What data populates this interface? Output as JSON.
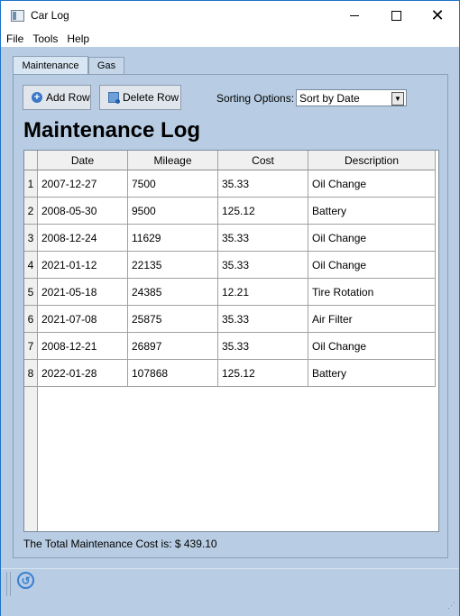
{
  "window": {
    "title": "Car Log"
  },
  "menu": [
    "File",
    "Tools",
    "Help"
  ],
  "tabs": [
    "Maintenance",
    "Gas"
  ],
  "toolbar": {
    "add_label": "Add Row",
    "delete_label": "Delete Row",
    "sort_label": "Sorting Options:",
    "sort_value": "Sort by Date"
  },
  "heading": "Maintenance Log",
  "table": {
    "columns": [
      "Date",
      "Mileage",
      "Cost",
      "Description"
    ],
    "rows": [
      [
        "2007-12-27",
        "7500",
        "35.33",
        "Oil Change"
      ],
      [
        "2008-05-30",
        "9500",
        "125.12",
        "Battery"
      ],
      [
        "2008-12-24",
        "11629",
        "35.33",
        "Oil Change"
      ],
      [
        "2021-01-12",
        "22135",
        "35.33",
        "Oil Change"
      ],
      [
        "2021-05-18",
        "24385",
        "12.21",
        "Tire Rotation"
      ],
      [
        "2021-07-08",
        "25875",
        "35.33",
        "Air Filter"
      ],
      [
        "2008-12-21",
        "26897",
        "35.33",
        "Oil Change"
      ],
      [
        "2022-01-28",
        "107868",
        "125.12",
        "Battery"
      ]
    ],
    "row_numbers": [
      "1",
      "2",
      "3",
      "4",
      "5",
      "6",
      "7",
      "8"
    ]
  },
  "total_text": "The Total Maintenance Cost is: $  439.10",
  "colors": {
    "accent": "#3b78c8",
    "background": "#b8cde3"
  },
  "icons": [
    "app-icon",
    "add-icon",
    "delete-icon",
    "back-icon"
  ]
}
